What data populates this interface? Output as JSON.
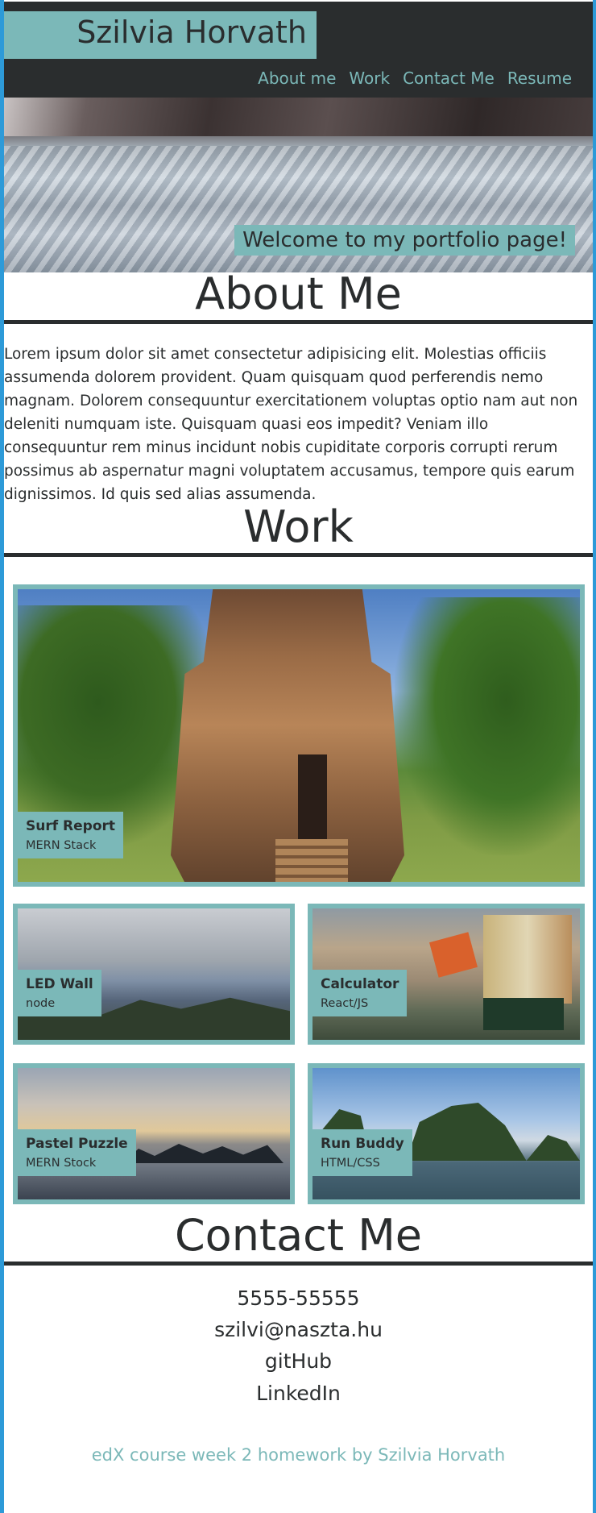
{
  "header": {
    "name": "Szilvia Horvath",
    "nav": [
      "About me",
      "Work",
      "Contact Me",
      "Resume"
    ]
  },
  "hero": {
    "welcome": "Welcome to my portfolio page!"
  },
  "about": {
    "title": "About Me",
    "text": "Lorem ipsum dolor sit amet consectetur adipisicing elit. Molestias officiis assumenda dolorem provident. Quam quisquam quod perferendis nemo magnam. Dolorem consequuntur exercitationem voluptas optio nam aut non deleniti numquam iste. Quisquam quasi eos impedit? Veniam illo consequuntur rem minus incidunt nobis cupiditate corporis corrupti rerum possimus ab aspernatur magni voluptatem accusamus, tempore quis earum dignissimos. Id quis sed alias assumenda."
  },
  "work": {
    "title": "Work",
    "projects": [
      {
        "title": "Surf Report",
        "stack": "MERN Stack"
      },
      {
        "title": "LED Wall",
        "stack": "node"
      },
      {
        "title": "Calculator",
        "stack": "React/JS"
      },
      {
        "title": "Pastel Puzzle",
        "stack": "MERN Stock"
      },
      {
        "title": "Run Buddy",
        "stack": "HTML/CSS"
      }
    ]
  },
  "contact": {
    "title": "Contact Me",
    "phone": "5555-55555",
    "email": "szilvi@naszta.hu",
    "github": "gitHub",
    "linkedin": "LinkedIn"
  },
  "footer": {
    "text": "edX course week 2 homework by Szilvia Horvath"
  },
  "colors": {
    "accent": "#7bb8b8",
    "dark": "#2a2d2e",
    "frame": "#2d9ad8"
  }
}
